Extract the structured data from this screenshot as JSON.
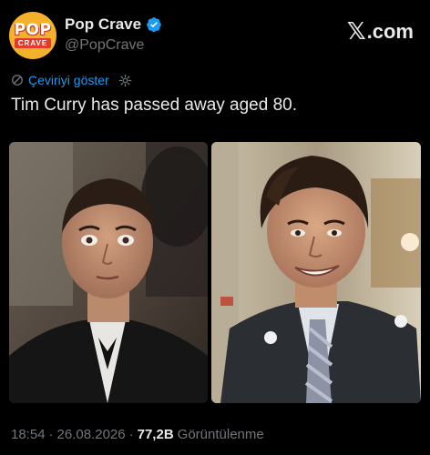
{
  "tweet": {
    "author": {
      "display_name": "Pop Crave",
      "handle": "@PopCrave",
      "avatar_top": "POP",
      "avatar_bottom": "CRAVE",
      "verified": true
    },
    "brand": {
      "label": ".com",
      "icon": "x-logo-icon"
    },
    "translate_label": "Çeviriyi göster",
    "text": "Tim Curry has passed away aged 80.",
    "media": [
      {
        "type": "photo",
        "description_icon": "photo"
      },
      {
        "type": "photo",
        "description_icon": "photo"
      }
    ],
    "time": "18:54",
    "date": "26.08.2026",
    "separator": "·",
    "views_count": "77,2B",
    "views_label": "Görüntülenme"
  },
  "colors": {
    "background": "#000000",
    "link": "#1d9bf0",
    "muted": "#71767b",
    "text": "#e7e9ea",
    "verified": "#1d9bf0"
  }
}
